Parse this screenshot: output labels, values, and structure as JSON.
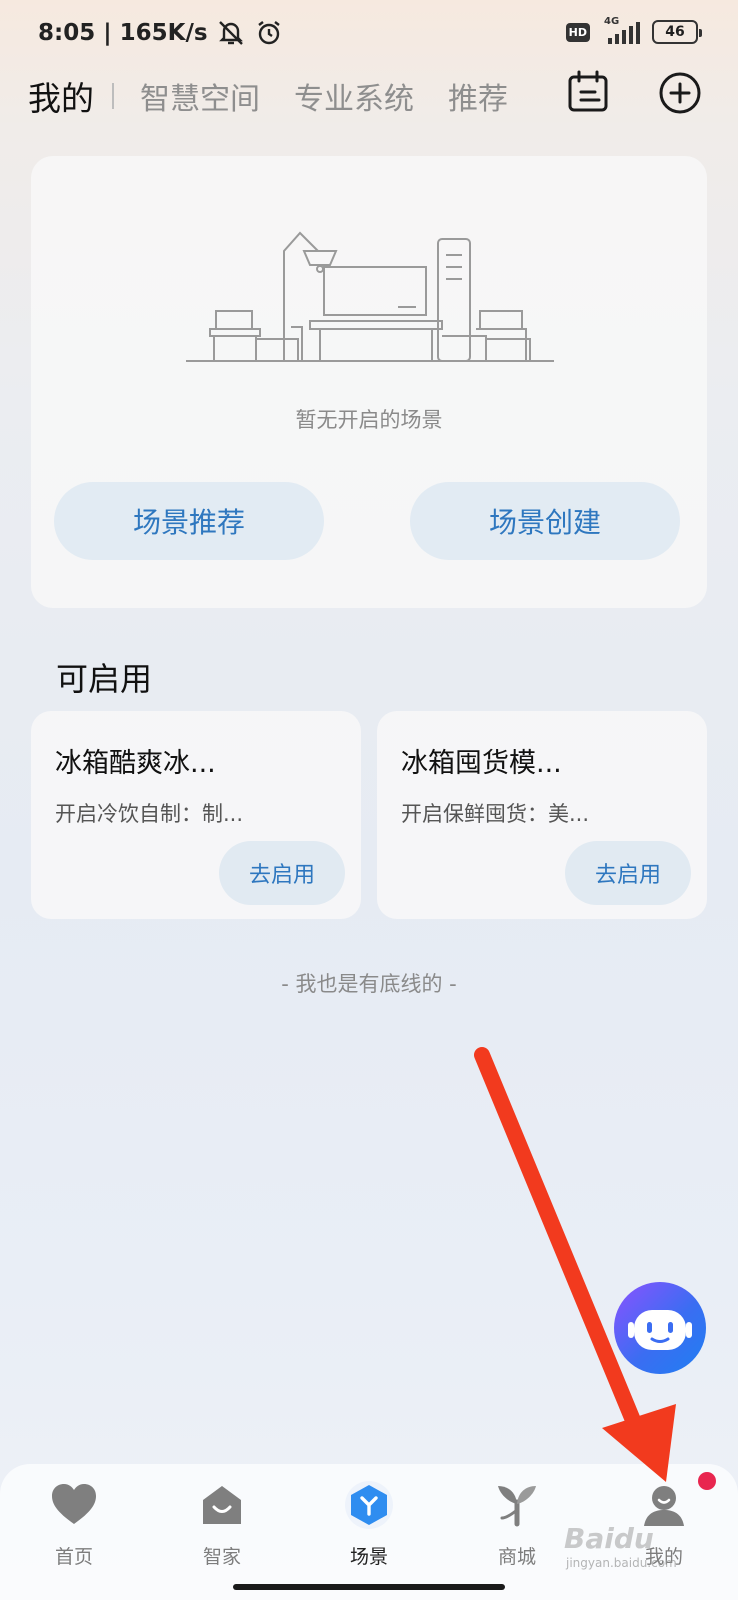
{
  "status_bar": {
    "time": "8:05",
    "speed": "165K/s",
    "hd": "HD",
    "network": "4G",
    "battery": "46"
  },
  "tabs": [
    {
      "label": "我的",
      "active": true
    },
    {
      "label": "智慧空间"
    },
    {
      "label": "专业系统"
    },
    {
      "label": "推荐"
    }
  ],
  "empty_card": {
    "message": "暂无开启的场景",
    "recommend_label": "场景推荐",
    "create_label": "场景创建"
  },
  "available": {
    "title": "可启用",
    "cards": [
      {
        "title": "冰箱酷爽冰...",
        "desc": "开启冷饮自制：制...",
        "button": "去启用"
      },
      {
        "title": "冰箱囤货模...",
        "desc": "开启保鲜囤货：美...",
        "button": "去启用"
      }
    ]
  },
  "bottom_text": "- 我也是有底线的 -",
  "bottom_nav": [
    {
      "label": "首页",
      "icon": "heart-icon"
    },
    {
      "label": "智家",
      "icon": "home-icon"
    },
    {
      "label": "场景",
      "icon": "scene-icon",
      "active": true
    },
    {
      "label": "商城",
      "icon": "sprout-icon"
    },
    {
      "label": "我的",
      "icon": "person-icon"
    }
  ],
  "colors": {
    "accent": "#2e77bf",
    "pill_bg": "#e2ebf3",
    "badge": "#e8264f",
    "arrow": "#f23a1e"
  },
  "watermark": {
    "main": "Baidu",
    "sub": "jingyan.baidu.com"
  }
}
